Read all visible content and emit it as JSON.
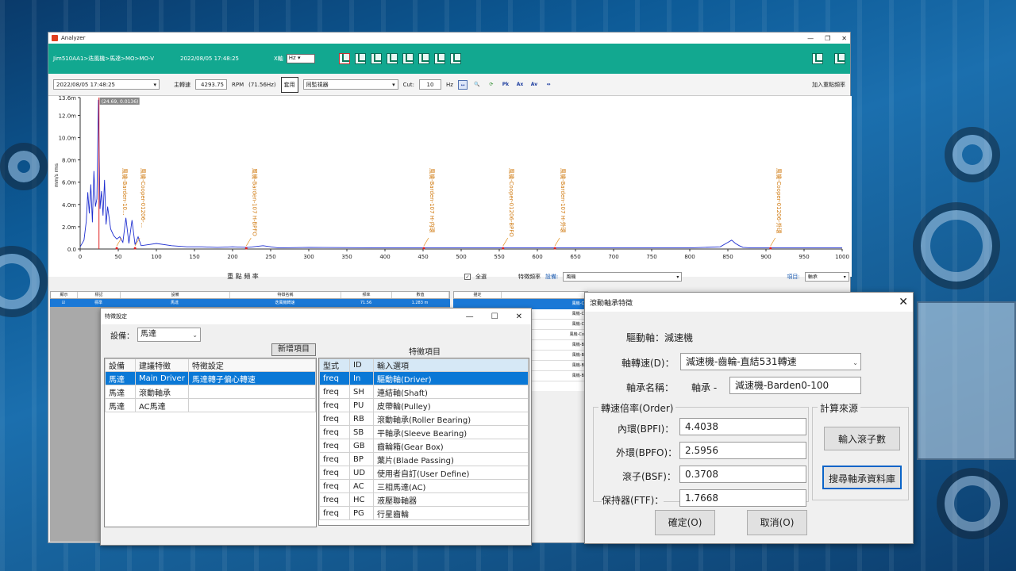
{
  "analyzer": {
    "app_title": "Analyzer",
    "path": "Jim510AA1>迭風機>馬達>MO>MO-V",
    "timestamp": "2022/08/05 17:48:25",
    "unit_select": "Hz",
    "date_select": "2022/08/05 17:48:25",
    "speed_label": "主轉速",
    "speed_value": "4293.75",
    "rpm_label": "RPM",
    "hz_text": "(71.56Hz)",
    "apply_label": "套用",
    "sync_select": "同監視器",
    "cut_label": "Cut:",
    "cut_value": "10",
    "cut_unit": "Hz",
    "add_freq_label": "加入重點頻率",
    "toolbar_btns": [
      "Pk",
      "Ax",
      "Av"
    ],
    "xaxis_title": "重 點 頻 率",
    "select_all_label": "全選",
    "feature_freq_label": "特徵頻率",
    "device_label": "設備:",
    "device_value": "風機",
    "item_label": "項目:",
    "item_value": "軸承",
    "grid_headers": [
      "顯示",
      "標記",
      "設備",
      "特徵名稱",
      "頻率",
      "數值"
    ],
    "grid_row": [
      "",
      "標準",
      "馬達",
      "迭風機轉速",
      "71.56",
      "1.283 m"
    ],
    "right_grid_header": "描定",
    "right_grid_rows": [
      "風機-Co",
      "風機-Co",
      "風機-Co",
      "風機-Coo",
      "風機-Ba",
      "風機-Ba",
      "風機-Ba",
      "風機-Ba"
    ]
  },
  "chart_data": {
    "type": "line",
    "title": "",
    "xlabel": "",
    "ylabel": "mm/s rms",
    "xlim": [
      0,
      1000
    ],
    "ylim": [
      0,
      13.6
    ],
    "xticks": [
      "0",
      "50",
      "100",
      "150",
      "200",
      "250",
      "300",
      "350",
      "400",
      "450",
      "500",
      "550",
      "600",
      "650",
      "700",
      "750",
      "800",
      "850",
      "900",
      "950",
      "1000"
    ],
    "yticks": [
      "0.0",
      "2.0m",
      "4.0m",
      "6.0m",
      "8.0m",
      "10.0m",
      "12.0m",
      "13.6m"
    ],
    "series": [
      {
        "x": [
          0,
          5,
          8,
          10,
          12,
          14,
          16,
          18,
          20,
          22,
          24,
          26,
          28,
          30,
          32,
          34,
          36,
          40,
          44,
          48,
          52,
          56,
          60,
          64,
          68,
          72,
          76,
          80,
          90,
          100,
          120,
          140,
          160,
          180,
          200,
          220,
          240,
          260,
          300,
          400,
          500,
          600,
          700,
          800,
          840,
          850,
          855,
          860,
          865,
          870,
          880,
          900,
          1000
        ],
        "y": [
          0.2,
          0.8,
          2.5,
          5.1,
          3.2,
          5.8,
          2.4,
          7.0,
          3.8,
          4.5,
          13.4,
          3.6,
          5.2,
          3.0,
          6.2,
          2.2,
          3.8,
          1.8,
          1.2,
          0.9,
          1.1,
          0.6,
          2.8,
          0.5,
          2.6,
          0.4,
          1.1,
          0.3,
          0.4,
          0.5,
          0.3,
          0.2,
          0.2,
          0.15,
          0.2,
          0.15,
          0.3,
          0.1,
          0.15,
          0.1,
          0.1,
          0.1,
          0.1,
          0.1,
          0.2,
          0.6,
          0.8,
          0.5,
          0.3,
          0.15,
          0.1,
          0.1,
          0.1
        ]
      }
    ],
    "cursor": {
      "x": 24.69,
      "y": 0.0136,
      "label": "(24.69, 0.0136)"
    },
    "markers": [
      {
        "x": 48,
        "label": "風機-Barden-10..."
      },
      {
        "x": 72,
        "label": "風機-Cooper-01206-..."
      },
      {
        "x": 218,
        "label": "風機-Barden-107 H-BPFO"
      },
      {
        "x": 451,
        "label": "風機-Barden-107 H-内環"
      },
      {
        "x": 555,
        "label": "風機-Cooper-01206-BPFO"
      },
      {
        "x": 623,
        "label": "風機-Barden-107 H-外環"
      },
      {
        "x": 906,
        "label": "風機-Cooper-01206-外環"
      }
    ]
  },
  "feature_dialog": {
    "title": "特徵設定",
    "device_label": "設備：",
    "device_value": "馬達",
    "add_button": "新增項目",
    "feature_items_title": "特徵項目",
    "left_headers": [
      "設備",
      "建議特徵",
      "特徵設定"
    ],
    "left_rows": [
      [
        "馬達",
        "Main Driver",
        "馬達轉子偏心轉速"
      ],
      [
        "馬達",
        "滾動軸承",
        ""
      ],
      [
        "馬達",
        "AC馬達",
        ""
      ]
    ],
    "right_headers": [
      "型式",
      "ID",
      "輸入選項"
    ],
    "right_rows": [
      [
        "freq",
        "In",
        "驅動軸(Driver)"
      ],
      [
        "freq",
        "SH",
        "連結軸(Shaft)"
      ],
      [
        "freq",
        "PU",
        "皮帶輪(Pulley)"
      ],
      [
        "freq",
        "RB",
        "滾動軸承(Roller Bearing)"
      ],
      [
        "freq",
        "SB",
        "平軸承(Sleeve Bearing)"
      ],
      [
        "freq",
        "GB",
        "齒輪箱(Gear Box)"
      ],
      [
        "freq",
        "BP",
        "葉片(Blade Passing)"
      ],
      [
        "freq",
        "UD",
        "使用者自訂(User Define)"
      ],
      [
        "freq",
        "AC",
        "三相馬達(AC)"
      ],
      [
        "freq",
        "HC",
        "液壓聯軸器"
      ],
      [
        "freq",
        "PG",
        "行星齒輪"
      ]
    ]
  },
  "bearing_dialog": {
    "title": "滾動軸承特徵",
    "drive_shaft": "驅動軸：減速機",
    "speed_label": "軸轉速(D)：",
    "speed_value": "減速機-齒輪-直結531轉速",
    "bearing_name_label": "軸承名稱：",
    "bearing_prefix": "軸承 -",
    "bearing_name_value": "減速機-Barden0-100",
    "order_group": "轉速倍率(Order)",
    "bpfi_label": "內環(BPFI)：",
    "bpfi_value": "4.4038",
    "bpfo_label": "外環(BPFO)：",
    "bpfo_value": "2.5956",
    "bsf_label": "滾子(BSF)：",
    "bsf_value": "0.3708",
    "ftf_label": "保持器(FTF)：",
    "ftf_value": "1.7668",
    "source_group": "計算來源",
    "input_roller_btn": "輸入滾子數",
    "search_db_btn": "搜尋軸承資料庫",
    "ok_btn": "確定(O)",
    "cancel_btn": "取消(O)"
  }
}
